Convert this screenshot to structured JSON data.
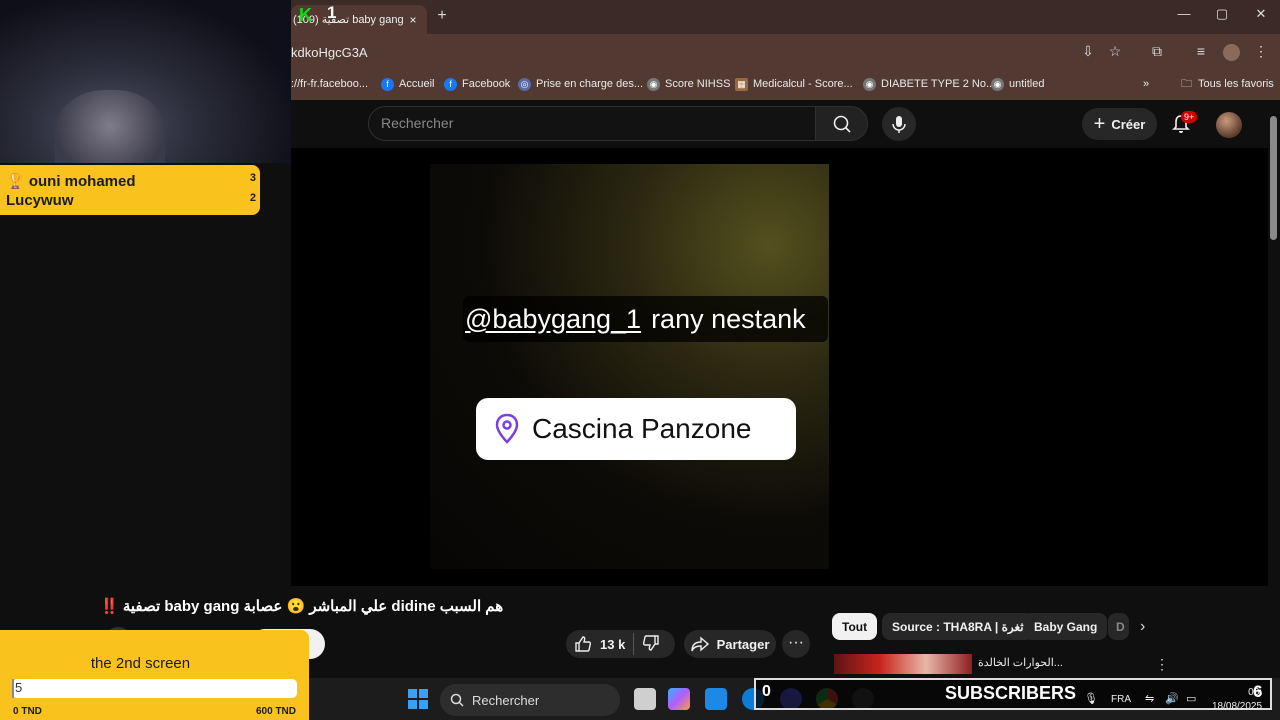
{
  "browser": {
    "tab_title": "(109) تصفية baby gang",
    "tab_close": "×",
    "new_tab": "+",
    "url": "kdkoHgcG3A",
    "window": {
      "minimize": "—",
      "maximize": "▢",
      "close": "✕"
    }
  },
  "bookmarks": [
    {
      "label": "://fr-fr.faceboo...",
      "icon": "text"
    },
    {
      "label": "Accueil",
      "icon": "facebook-icon"
    },
    {
      "label": "Facebook",
      "icon": "facebook-icon"
    },
    {
      "label": "Prise en charge des...",
      "icon": "nihss-icon"
    },
    {
      "label": "Score NIHSS",
      "icon": "globe-icon"
    },
    {
      "label": "Medicalcul - Score...",
      "icon": "medicalcul-icon"
    },
    {
      "label": "DIABETE TYPE 2 No...",
      "icon": "globe-icon"
    },
    {
      "label": "untitled",
      "icon": "globe-icon"
    }
  ],
  "bookmarks_more": "»",
  "all_favorites": "Tous les favoris",
  "youtube": {
    "search_placeholder": "Rechercher",
    "create_label": "Créer",
    "notifications_badge": "9+"
  },
  "video": {
    "handle": "@babygang_1",
    "handle_suffix": "rany nestank",
    "location": "Cascina Panzone",
    "title": "هم السبب didine علي المباشر 😮 عصابة baby gang تصفية",
    "title_mark": "‼️",
    "likes": "13 k",
    "share_label": "Partager",
    "more": "···"
  },
  "chips": [
    "Tout",
    "Source : THA8RA | ثغرة",
    "Baby Gang",
    "D"
  ],
  "recommended": {
    "title": "الحوارات الخالدة..."
  },
  "stream_overlay": {
    "k_label": "K",
    "k_count": "1",
    "leaderboard": [
      {
        "name": "🏆 ouni mohamed",
        "count": "3"
      },
      {
        "name": "Lucywuw",
        "count": "2"
      }
    ],
    "goal": {
      "title": "the 2nd screen",
      "current": "5",
      "progress": 0.008,
      "min": "0 TND",
      "max": "600 TND"
    },
    "subscribers_count": "0",
    "subscribers_label": "SUBSCRIBERS",
    "big_number": "6"
  },
  "taskbar": {
    "search_label": "Rechercher",
    "language": "FRA",
    "time": "06:",
    "date": "18/08/2025"
  }
}
